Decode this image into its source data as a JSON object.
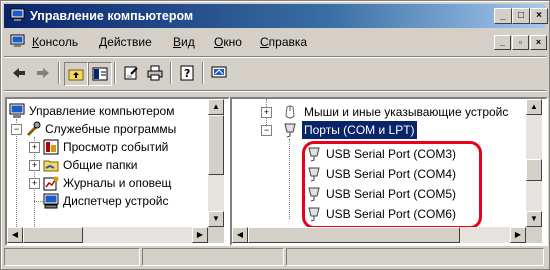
{
  "window": {
    "title": "Управление компьютером",
    "controls": {
      "minimize": "_",
      "maximize": "□",
      "close": "×"
    }
  },
  "menu": {
    "items": [
      {
        "label": "Консоль",
        "underline": "К",
        "rest": "онсоль"
      },
      {
        "label": "Действие",
        "underline": "Д",
        "rest": "ействие"
      },
      {
        "label": "Вид",
        "underline": "В",
        "rest": "ид"
      },
      {
        "label": "Окно",
        "underline": "О",
        "rest": "кно"
      },
      {
        "label": "Справка",
        "underline": "С",
        "rest": "правка"
      }
    ],
    "mdi_controls": {
      "minimize": "_",
      "restore": "▫",
      "close": "×"
    }
  },
  "toolbar": {
    "buttons": [
      "back-icon",
      "forward-icon",
      "up-folder-icon",
      "show-tree-icon",
      "properties-icon",
      "print-icon",
      "help-icon",
      "device-icon"
    ]
  },
  "left_tree": {
    "items": [
      {
        "label": "Управление компьютером",
        "icon": "computer-icon"
      },
      {
        "label": "Служебные программы",
        "icon": "tools-icon",
        "expander": "−"
      },
      {
        "label": "Просмотр событий",
        "icon": "event-viewer-icon",
        "expander": "+"
      },
      {
        "label": "Общие папки",
        "icon": "shared-folder-icon",
        "expander": "+"
      },
      {
        "label": "Журналы и оповещ",
        "icon": "logs-icon",
        "expander": "+"
      },
      {
        "label": "Диспетчер устройс",
        "icon": "device-manager-icon"
      }
    ]
  },
  "right_tree": {
    "items": [
      {
        "label": "Мыши и иные указывающие устройс",
        "icon": "mouse-icon",
        "expander": "+"
      },
      {
        "label": "Порты (COM и LPT)",
        "icon": "port-icon",
        "expander": "−",
        "selected": true
      },
      {
        "label": "USB Serial Port (COM3)",
        "icon": "port-icon"
      },
      {
        "label": "USB Serial Port (COM4)",
        "icon": "port-icon"
      },
      {
        "label": "USB Serial Port (COM5)",
        "icon": "port-icon"
      },
      {
        "label": "USB Serial Port (COM6)",
        "icon": "port-icon"
      }
    ]
  },
  "colors": {
    "title_start": "#0a246a",
    "title_end": "#a6caf0",
    "highlight_box": "#e8001c",
    "face": "#d4d0c8"
  }
}
